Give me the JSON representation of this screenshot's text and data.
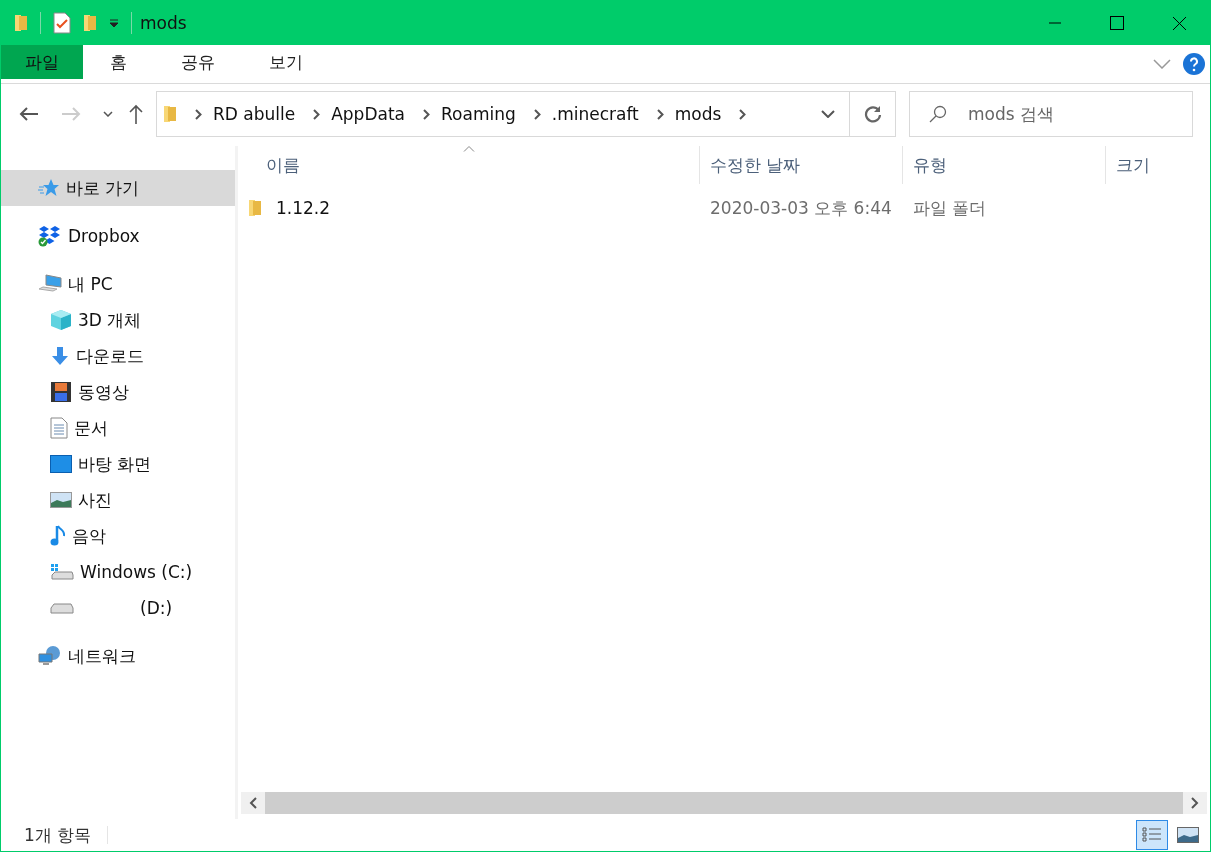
{
  "window": {
    "title": "mods"
  },
  "ribbon_tabs": [
    {
      "label": "파일",
      "selected": true
    },
    {
      "label": "홈",
      "selected": false
    },
    {
      "label": "공유",
      "selected": false
    },
    {
      "label": "보기",
      "selected": false
    }
  ],
  "address": {
    "breadcrumbs": [
      "RD abulle",
      "AppData",
      "Roaming",
      ".minecraft",
      "mods"
    ]
  },
  "search": {
    "placeholder": "mods 검색"
  },
  "sidebar": {
    "items": [
      {
        "label": "바로 가기",
        "selected": true
      },
      {
        "label": "Dropbox",
        "selected": false
      },
      {
        "label": "내 PC",
        "selected": false,
        "children": [
          {
            "label": "3D 개체",
            "selected": false
          },
          {
            "label": "다운로드",
            "selected": false
          },
          {
            "label": "동영상",
            "selected": false
          },
          {
            "label": "문서",
            "selected": false
          },
          {
            "label": "바탕 화면",
            "selected": false
          },
          {
            "label": "사진",
            "selected": false
          },
          {
            "label": "음악",
            "selected": false
          },
          {
            "label": "Windows (C:)",
            "selected": false
          },
          {
            "label": "(D:)",
            "selected": false
          }
        ]
      },
      {
        "label": "네트워크",
        "selected": false
      }
    ]
  },
  "table": {
    "columns": [
      {
        "label": "이름",
        "sorted": true
      },
      {
        "label": "수정한 날짜",
        "sorted": false
      },
      {
        "label": "유형",
        "sorted": false
      },
      {
        "label": "크기",
        "sorted": false
      }
    ],
    "rows": [
      {
        "cells": [
          "1.12.2",
          "2020-03-03 오후 6:44",
          "파일 폴더"
        ]
      }
    ]
  },
  "status_bar": {
    "text": "1개 항목"
  },
  "view_buttons": [
    {
      "selected": true
    },
    {
      "selected": false
    }
  ]
}
